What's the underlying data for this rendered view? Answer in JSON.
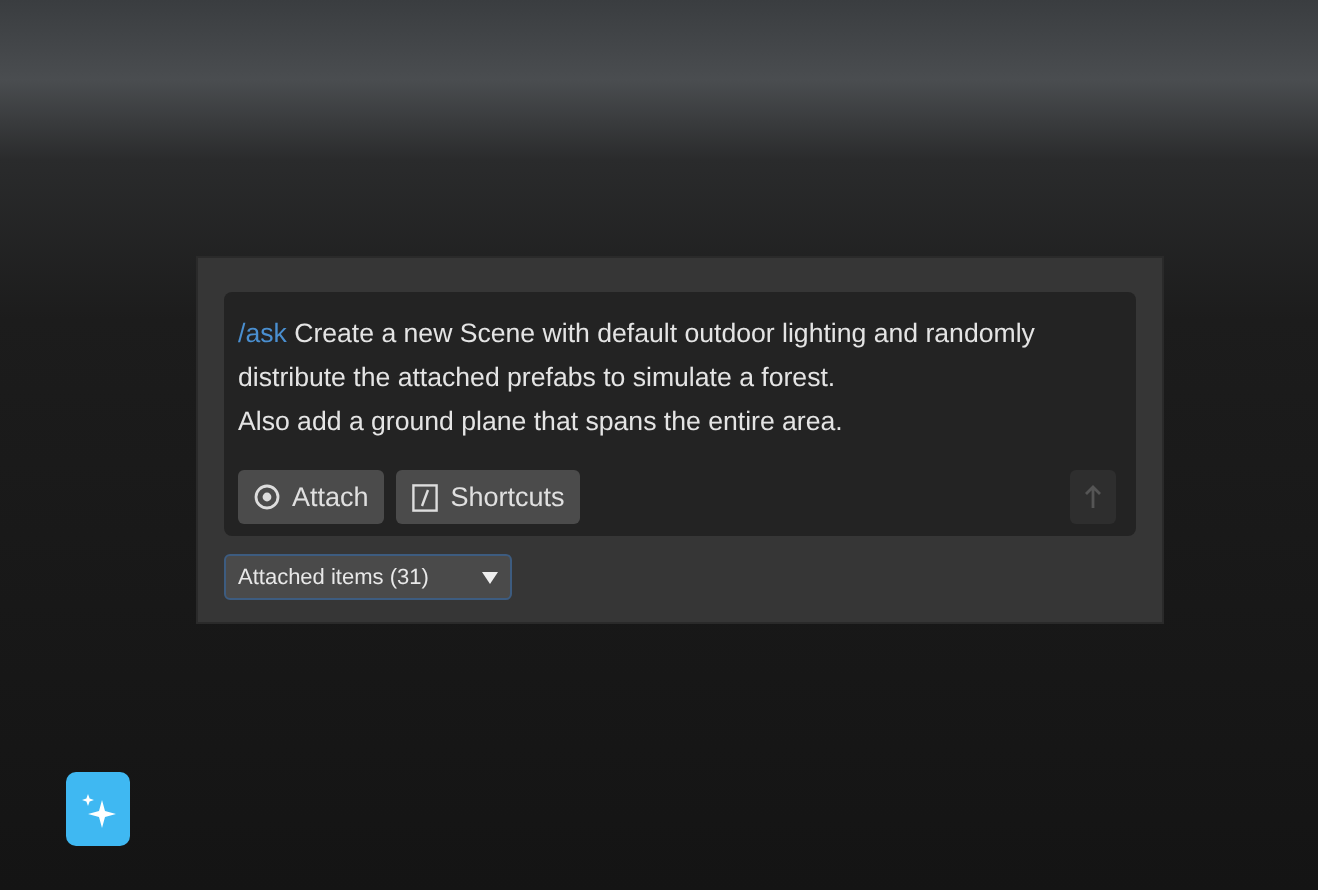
{
  "prompt": {
    "command": "/ask",
    "text": "Create a new Scene with default outdoor lighting and randomly distribute the attached prefabs to simulate a forest.\nAlso add a ground plane that spans the entire area."
  },
  "buttons": [
    {
      "kind": "attach",
      "label": "Attach"
    },
    {
      "kind": "shortcuts",
      "label": "Shortcuts"
    }
  ],
  "send_button": {
    "disabled": true
  },
  "attached_dropdown": {
    "label": "Attached items (31)"
  }
}
